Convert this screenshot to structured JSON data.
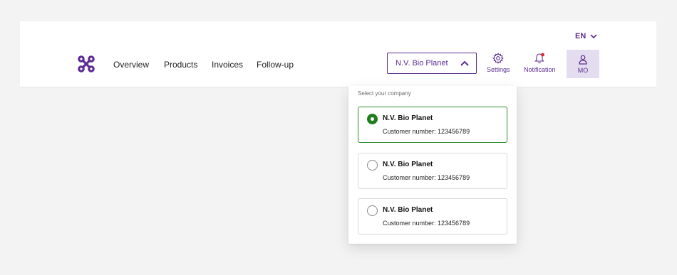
{
  "header": {
    "language": "EN",
    "nav": [
      "Overview",
      "Products",
      "Invoices",
      "Follow-up"
    ],
    "company_select": "N.V. Bio Planet",
    "settings_label": "Settings",
    "notification_label": "Notification",
    "user_initials": "MO"
  },
  "dropdown": {
    "heading": "Select your company",
    "options": [
      {
        "name": "N.V. Bio Planet",
        "customer": "Customer number: 123456789",
        "selected": true
      },
      {
        "name": "N.V. Bio Planet",
        "customer": "Customer number: 123456789",
        "selected": false
      },
      {
        "name": "N.V. Bio Planet",
        "customer": "Customer number: 123456789",
        "selected": false
      }
    ]
  },
  "colors": {
    "brand": "#5c2d91",
    "selected": "#1e7d1e",
    "notification_dot": "#e0242e"
  },
  "icons": [
    "chevron-down-icon",
    "logo-icon",
    "chevron-up-icon",
    "gear-icon",
    "bell-icon",
    "user-icon"
  ]
}
